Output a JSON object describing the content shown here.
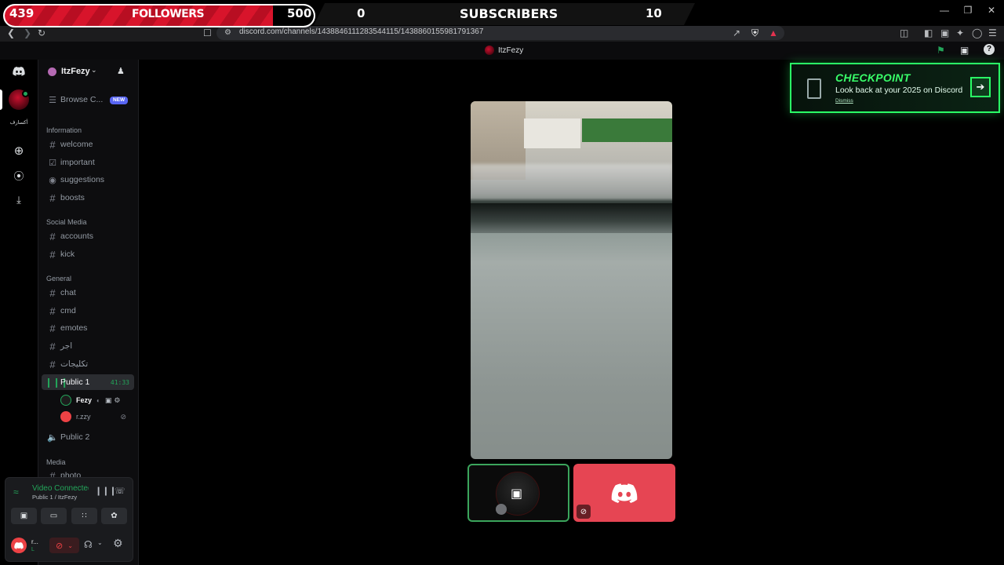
{
  "overlay": {
    "followers_count": "439",
    "followers_label": "FOLLOWERS",
    "followers_goal": "500",
    "followers_progress": 0.878,
    "subscribers_count": "0",
    "subscribers_label": "SUBSCRIBERS",
    "subscribers_goal": "10"
  },
  "browser": {
    "url": "discord.com/channels/1438846111283544115/1438860155981791367"
  },
  "titlebar": {
    "title": "ItzFezy"
  },
  "server": {
    "name": "ItzFezy"
  },
  "browse": {
    "label": "Browse C...",
    "badge": "NEW"
  },
  "categories": {
    "information": "Information",
    "social": "Social Media",
    "general": "General",
    "media": "Media"
  },
  "channels": {
    "welcome": "welcome",
    "important": "important",
    "suggestions": "suggestions",
    "boosts": "boosts",
    "accounts": "accounts",
    "kick": "kick",
    "chat": "chat",
    "cmd": "cmd",
    "emotes": "emotes",
    "ajr": "اجر",
    "takhayyulat": "تكليجات",
    "public1": "Public 1",
    "public1_time": "41:33",
    "public2": "Public 2",
    "photo": "photo"
  },
  "voice_users": {
    "user1": "Fezy",
    "user2": "r.zzy"
  },
  "rail": {
    "server_text": "أكسارف"
  },
  "voice_panel": {
    "status": "Video Connected",
    "location": "Public 1 / ItzFezy"
  },
  "user_panel": {
    "name": "r...",
    "sub": "L"
  },
  "checkpoint": {
    "title": "CHECKPOINT",
    "subtitle": "Look back at your 2025 on Discord",
    "dismiss": "Dismiss"
  },
  "colors": {
    "accent_green": "#23a55a",
    "blurple": "#5865f2",
    "discord_red": "#e64553",
    "overlay_red": "#d8142b",
    "checkpoint_green": "#2aff66"
  }
}
